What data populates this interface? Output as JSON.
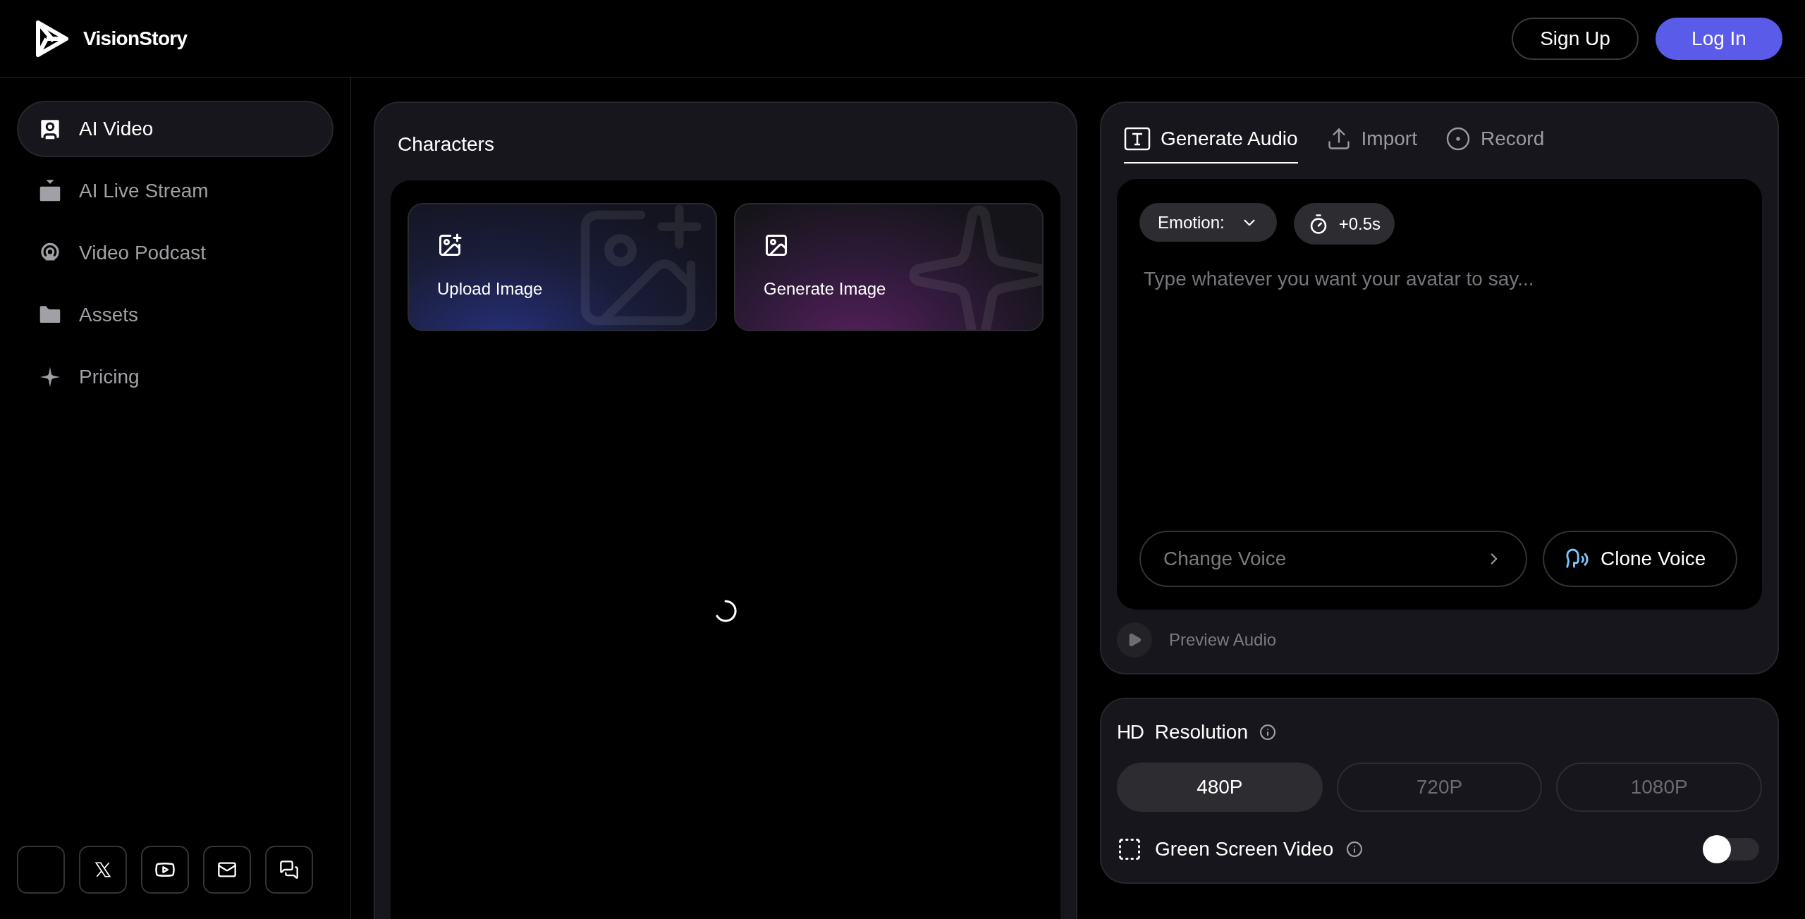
{
  "header": {
    "brand": "VisionStory",
    "buttons": [
      {
        "label": "Sign Up",
        "kind": "outline"
      },
      {
        "label": "Log In",
        "kind": "primary"
      }
    ]
  },
  "sidebar": {
    "items": [
      {
        "label": "AI Video",
        "selected": true
      },
      {
        "label": "AI Live Stream",
        "selected": false
      },
      {
        "label": "Video Podcast",
        "selected": false
      },
      {
        "label": "Assets",
        "selected": false
      },
      {
        "label": "Pricing",
        "selected": false
      }
    ]
  },
  "characters": {
    "title": "Characters",
    "cards": [
      {
        "label": "Upload Image",
        "kind": "upload"
      },
      {
        "label": "Generate Image",
        "kind": "generate"
      }
    ]
  },
  "audio": {
    "tabs": [
      {
        "label": "Generate Audio",
        "selected": true
      },
      {
        "label": "Import",
        "selected": false
      },
      {
        "label": "Record",
        "selected": false
      }
    ],
    "emotion": "Emotion:",
    "pause": "+0.5s",
    "placeholder": "Type whatever you want your avatar to say...",
    "change_voice": "Change Voice",
    "clone_voice": "Clone Voice",
    "preview": "Preview Audio"
  },
  "resolution": {
    "badge": "HD",
    "title": "Resolution",
    "options": [
      {
        "label": "480P",
        "selected": true
      },
      {
        "label": "720P",
        "selected": false
      },
      {
        "label": "1080P",
        "selected": false
      }
    ]
  },
  "green_screen": {
    "label": "Green Screen Video",
    "on": false
  }
}
